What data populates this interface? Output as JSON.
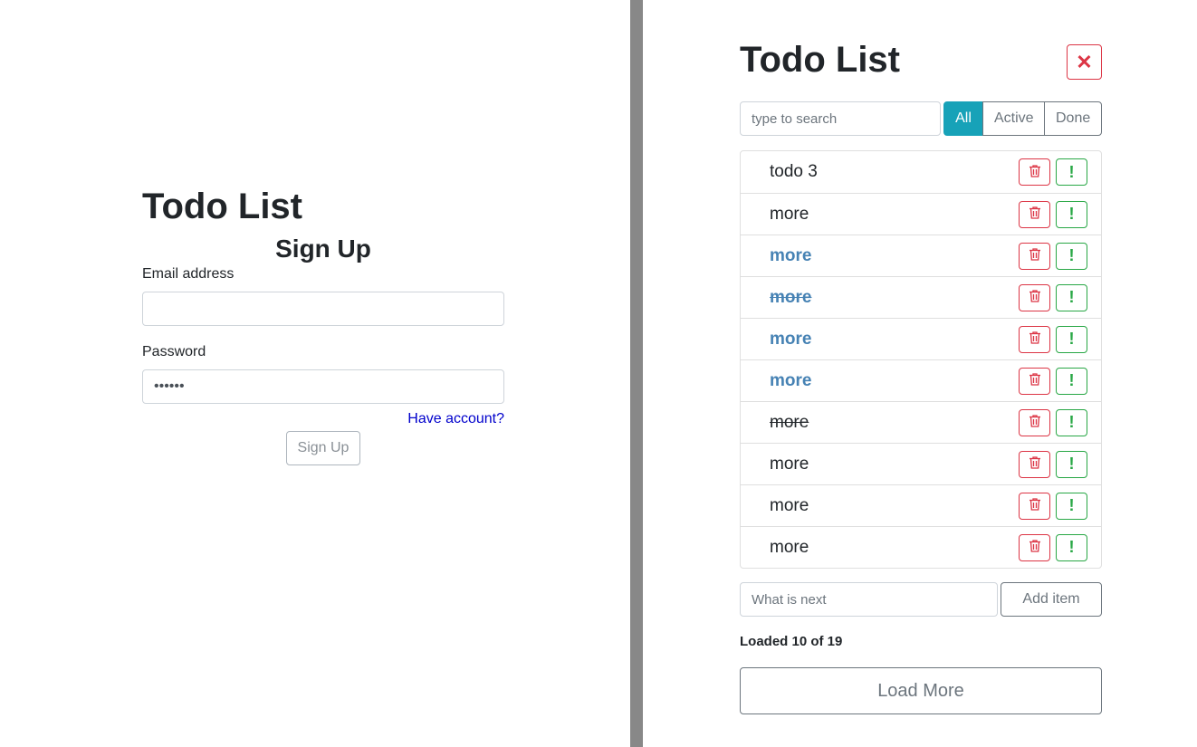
{
  "signup": {
    "app_title": "Todo List",
    "form_title": "Sign Up",
    "email_label": "Email address",
    "email_value": "",
    "password_label": "Password",
    "password_value": "123456",
    "have_account_link": "Have account?",
    "submit_label": "Sign Up"
  },
  "todo": {
    "title": "Todo List",
    "close_icon": "✕",
    "search_placeholder": "type to search",
    "filters": [
      {
        "label": "All",
        "active": true
      },
      {
        "label": "Active",
        "active": false
      },
      {
        "label": "Done",
        "active": false
      }
    ],
    "items": [
      {
        "label": "todo 3",
        "important": false,
        "done": false
      },
      {
        "label": "more",
        "important": false,
        "done": false
      },
      {
        "label": "more",
        "important": true,
        "done": false
      },
      {
        "label": "more",
        "important": true,
        "done": true
      },
      {
        "label": "more",
        "important": true,
        "done": false
      },
      {
        "label": "more",
        "important": true,
        "done": false
      },
      {
        "label": "more",
        "important": false,
        "done": true
      },
      {
        "label": "more",
        "important": false,
        "done": false
      },
      {
        "label": "more",
        "important": false,
        "done": false
      },
      {
        "label": "more",
        "important": false,
        "done": false
      }
    ],
    "important_glyph": "!",
    "add_placeholder": "What is next",
    "add_label": "Add item",
    "loaded_text": "Loaded 10 of 19",
    "load_more_label": "Load More"
  },
  "colors": {
    "accent": "#17a2b8",
    "danger": "#dc3545",
    "success": "#28a745",
    "important_text": "#4682b4",
    "divider": "#888888"
  }
}
